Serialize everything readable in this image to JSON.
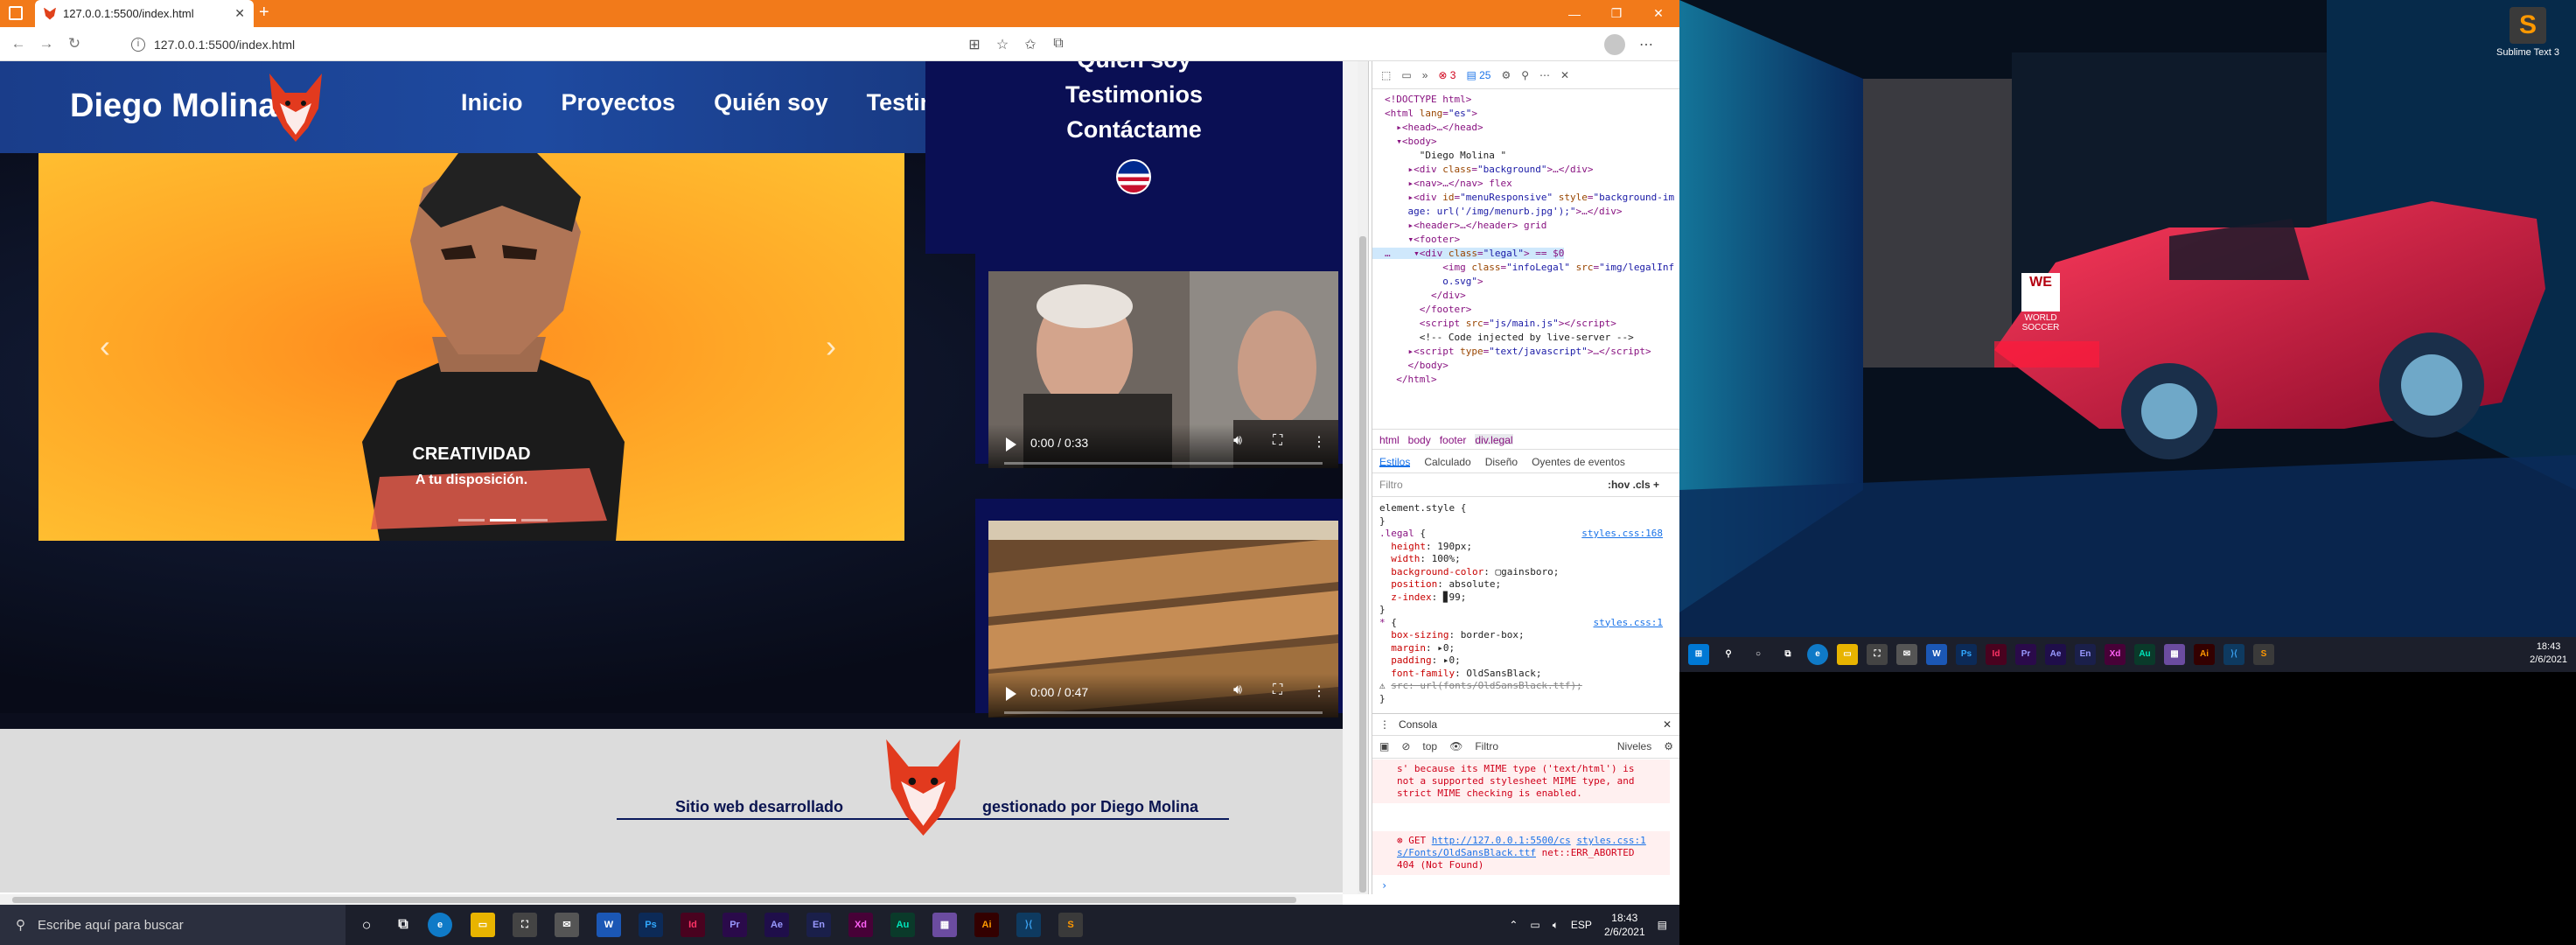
{
  "browser": {
    "tab_title": "127.0.0.1:5500/index.html",
    "url": "127.0.0.1:5500/index.html"
  },
  "site": {
    "brand": "Diego Molina",
    "nav": [
      "Inicio",
      "Proyectos",
      "Quién soy",
      "Testimonios"
    ],
    "menu_responsive": [
      "Quién soy",
      "Testimonios",
      "Contáctame"
    ],
    "carousel": {
      "caption_title": "CREATIVIDAD",
      "caption_sub": "A tu disposición.",
      "slides": 3,
      "active_slide": 1
    },
    "videos": [
      {
        "time": "0:00 / 0:33"
      },
      {
        "time": "0:00 / 0:47"
      }
    ],
    "legal_left": "Sitio web desarrollado",
    "legal_right": "gestionado por Diego Molina"
  },
  "devtools": {
    "errors": "3",
    "messages": "25",
    "crumbs": [
      "html",
      "body",
      "footer",
      "div.legal"
    ],
    "subtabs": [
      "Estilos",
      "Calculado",
      "Diseño",
      "Oyentes de eventos"
    ],
    "filter_placeholder": "Filtro",
    "filter_tools": ":hov  .cls  +",
    "console_title": "Consola",
    "console_context": "top",
    "console_filter": "Filtro",
    "console_levels": "Niveles"
  },
  "taskbar": {
    "search_placeholder": "Escribe aquí para buscar",
    "lang": "ESP",
    "time": "18:43",
    "date": "2/6/2021"
  },
  "monitor2": {
    "sublime_label": "Sublime Text 3",
    "desktop_icon": "WORLD SOCCER",
    "time": "18:43",
    "date": "2/6/2021"
  },
  "colors": {
    "tabbar": "#f27a1a",
    "header": "#1e4aa0",
    "menu_navy": "#0a0f54",
    "carousel_orange": "#ffa626",
    "footer_gray": "#dcdcdc"
  }
}
